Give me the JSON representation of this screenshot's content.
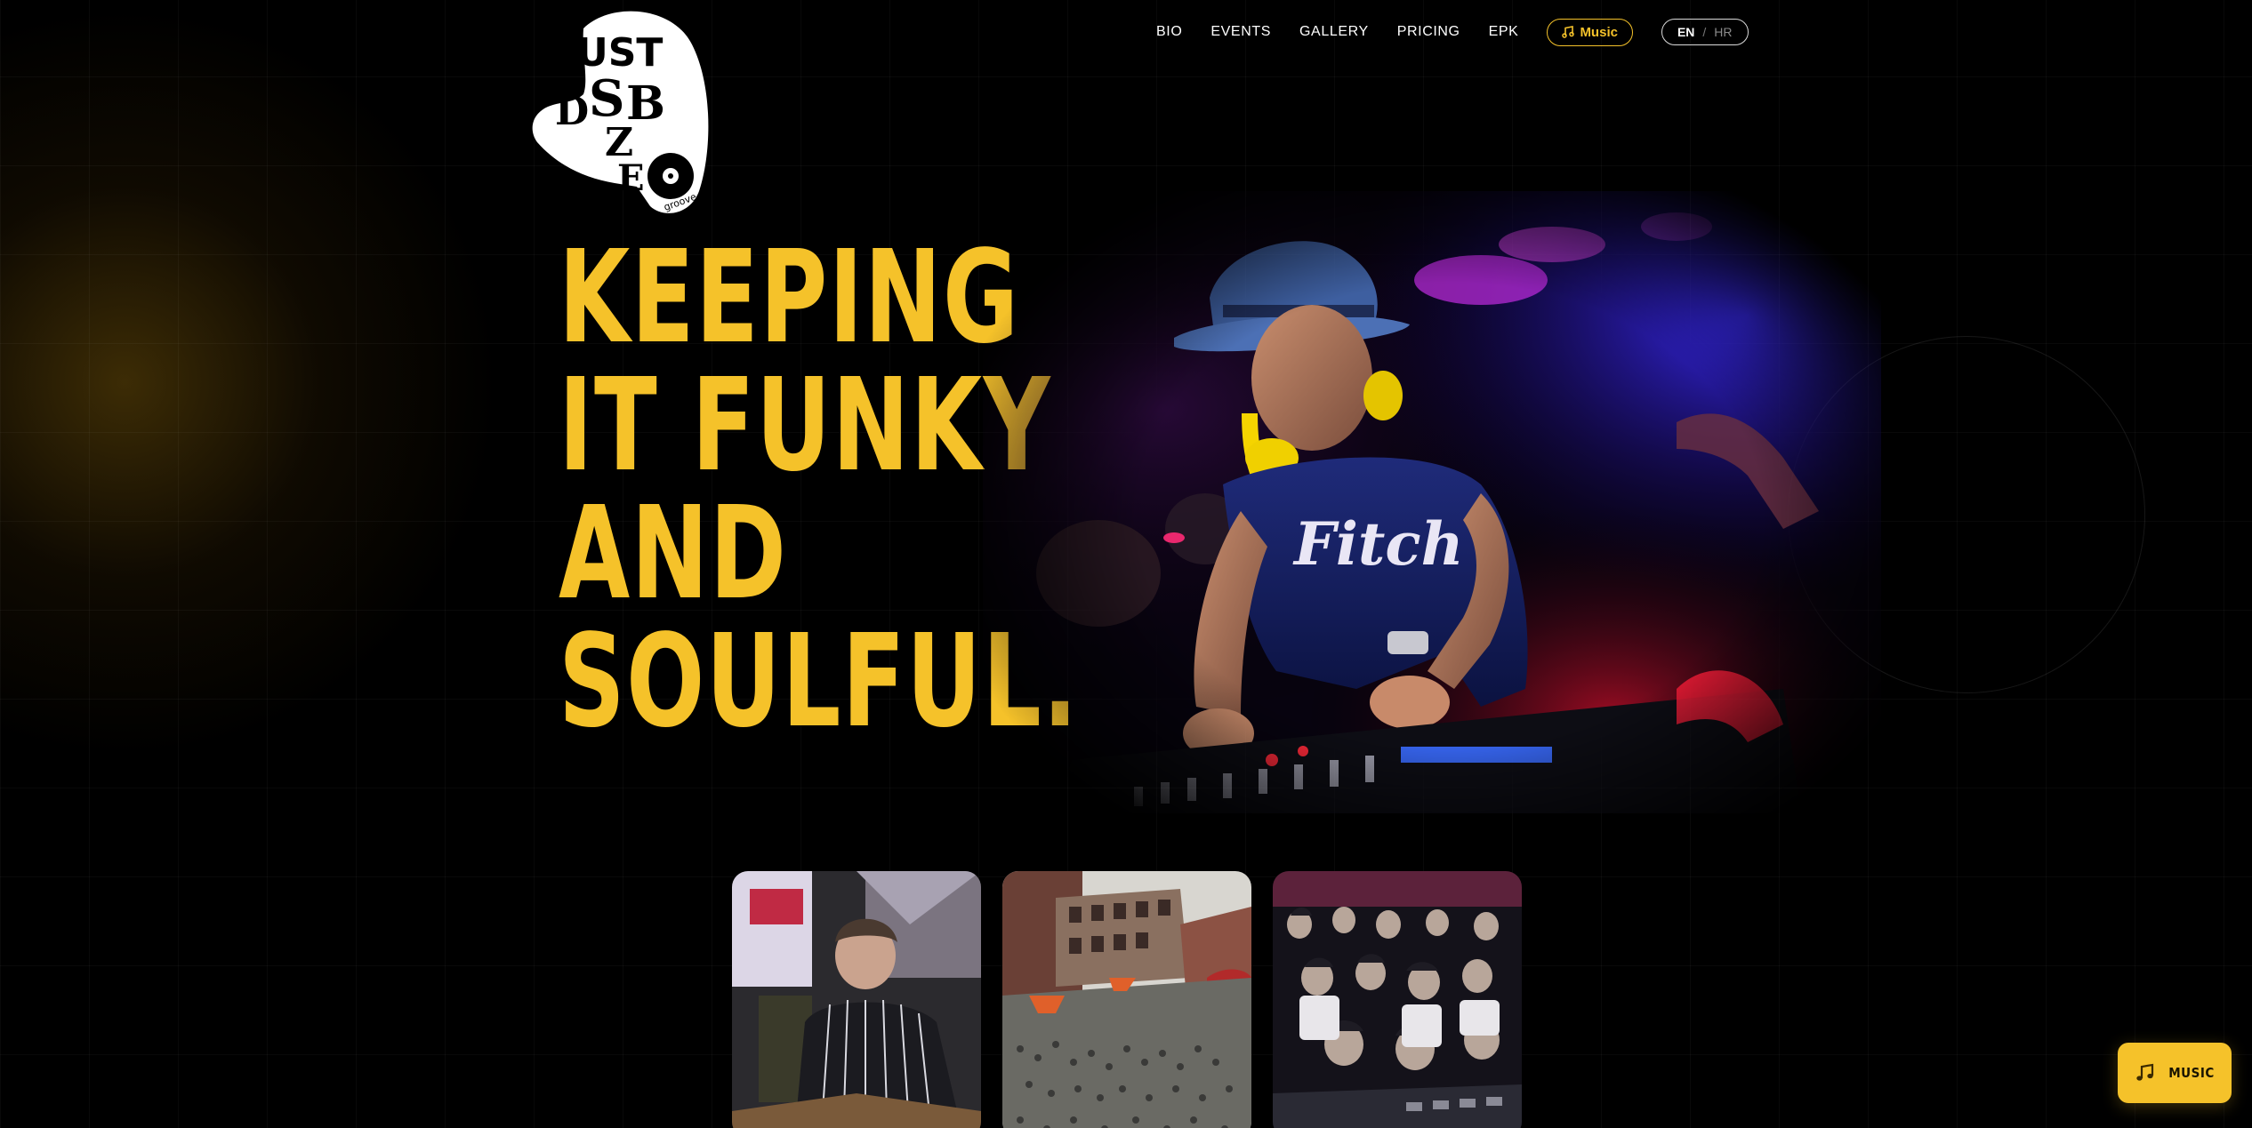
{
  "brand": {
    "logo_text": "JUST DZ BOZE GROOVE"
  },
  "nav": {
    "items": [
      {
        "label": "BIO"
      },
      {
        "label": "EVENTS"
      },
      {
        "label": "GALLERY"
      },
      {
        "label": "PRICING"
      },
      {
        "label": "EPK"
      }
    ],
    "music_label": "Music",
    "lang": {
      "active": "EN",
      "separator": "/",
      "inactive": "HR"
    }
  },
  "hero": {
    "lines": [
      "KEEPING",
      "IT FUNKY",
      "AND",
      "SOULFUL."
    ],
    "photo_shirt_text": "Fitch"
  },
  "fab": {
    "label": "MUSIC",
    "icon": "music-note-icon"
  },
  "colors": {
    "accent": "#f5c22a",
    "background": "#000000"
  }
}
